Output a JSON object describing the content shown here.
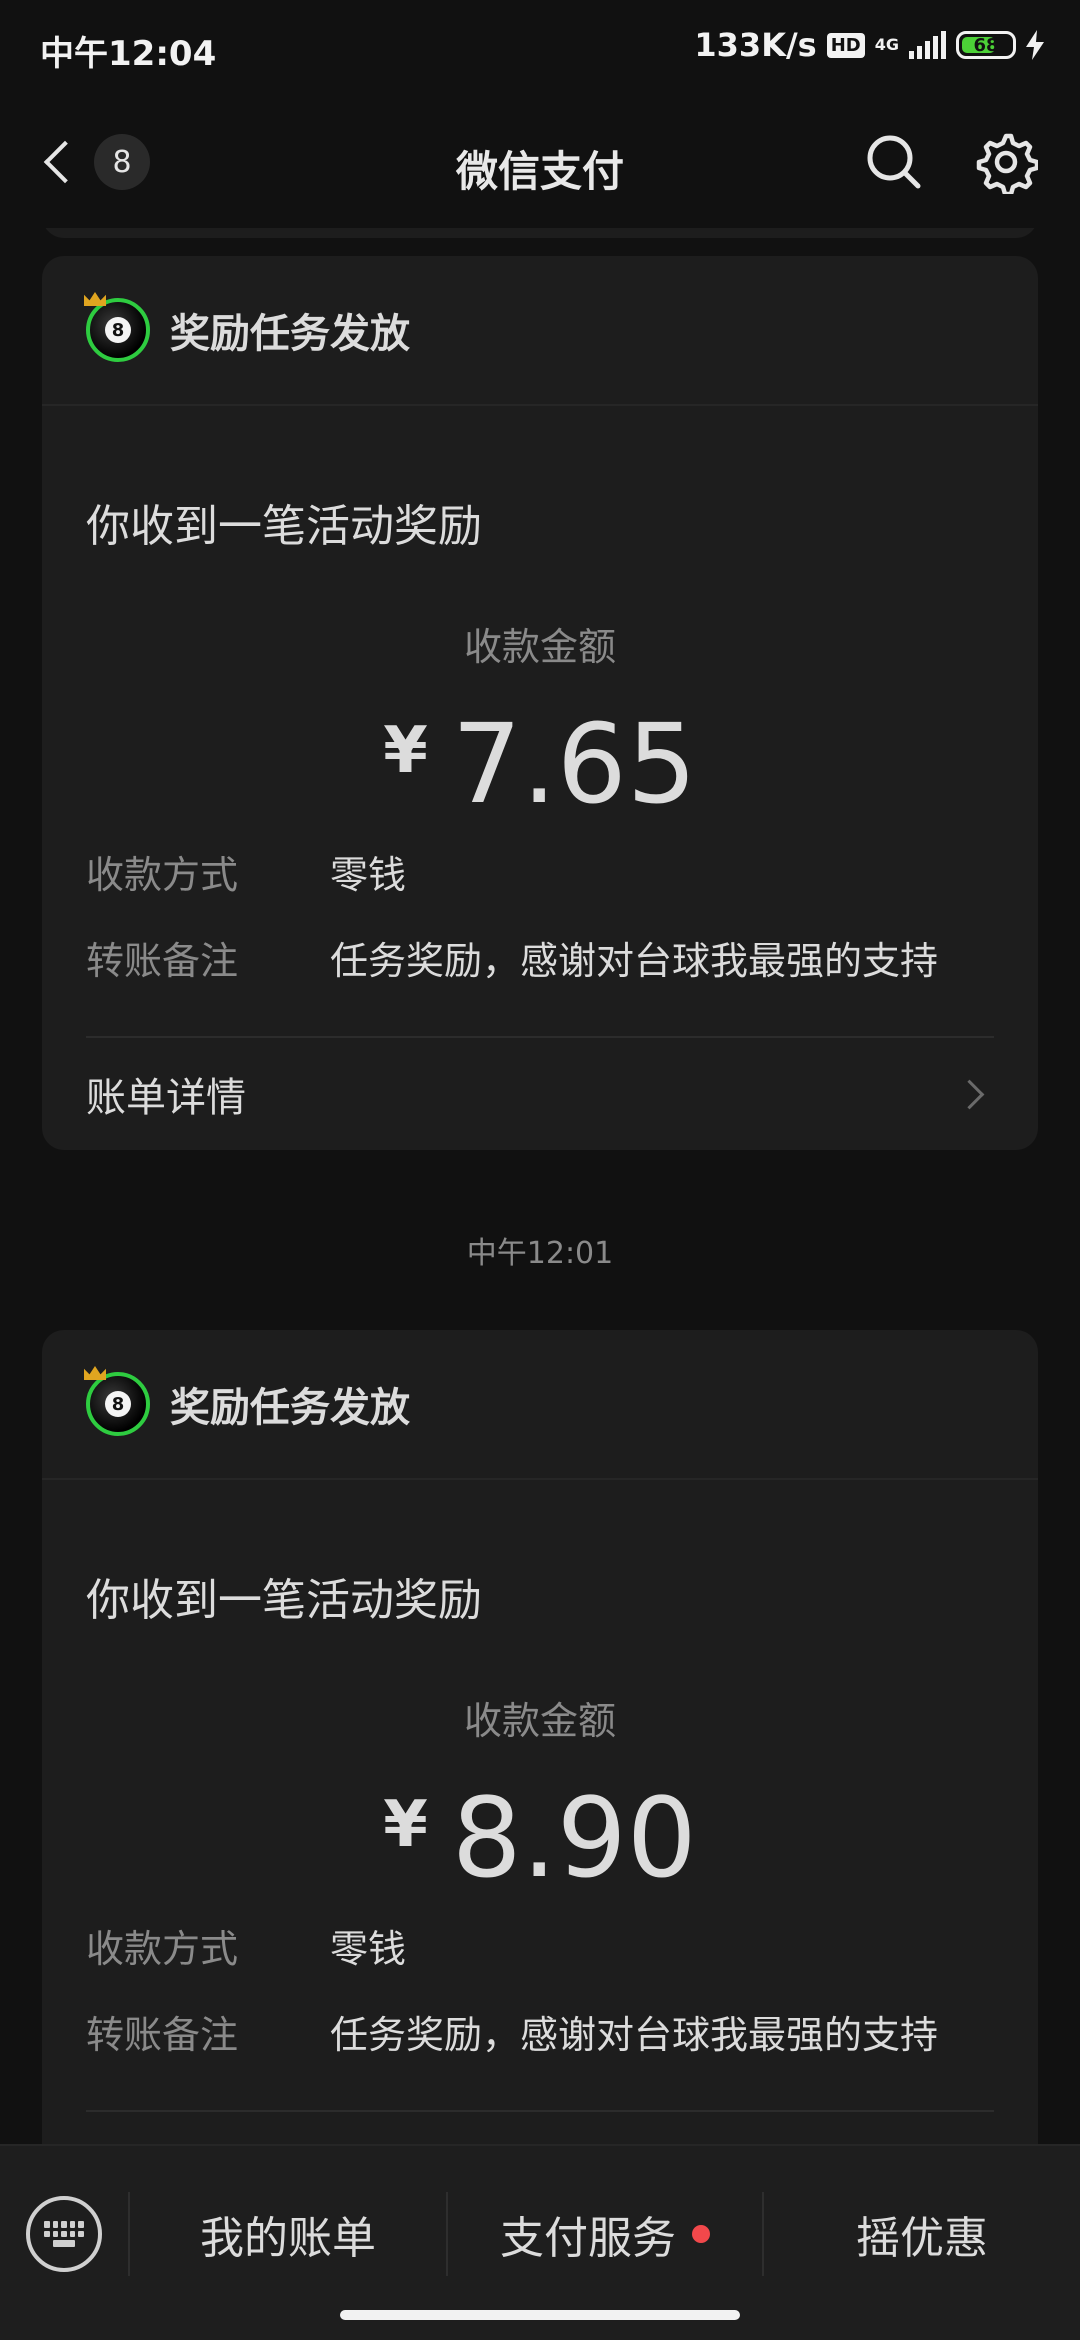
{
  "status_bar": {
    "time": "中午12:04",
    "net_speed": "133K/s",
    "hd_label": "HD",
    "network_type": "4G",
    "battery_level": "68",
    "battery_fraction": 0.68
  },
  "nav": {
    "title": "微信支付",
    "unread_count": "8"
  },
  "messages": [
    {
      "sender": "奖励任务发放",
      "headline": "你收到一笔活动奖励",
      "amount_label": "收款金额",
      "currency": "¥",
      "amount": "7.65",
      "method_key": "收款方式",
      "method_val": "零钱",
      "note_key": "转账备注",
      "note_val": "任务奖励，感谢对台球我最强的支持",
      "bill_link": "账单详情"
    },
    {
      "sender": "奖励任务发放",
      "headline": "你收到一笔活动奖励",
      "amount_label": "收款金额",
      "currency": "¥",
      "amount": "8.90",
      "method_key": "收款方式",
      "method_val": "零钱",
      "note_key": "转账备注",
      "note_val": "任务奖励，感谢对台球我最强的支持"
    }
  ],
  "timestamp_between": "中午12:01",
  "bottom_menu": {
    "item_1": "我的账单",
    "item_2": "支付服务",
    "item_3": "摇优惠"
  },
  "colors": {
    "background": "#111111",
    "card": "#1d1d1d",
    "accent_dot": "#f2484b",
    "battery": "#4cd137"
  }
}
